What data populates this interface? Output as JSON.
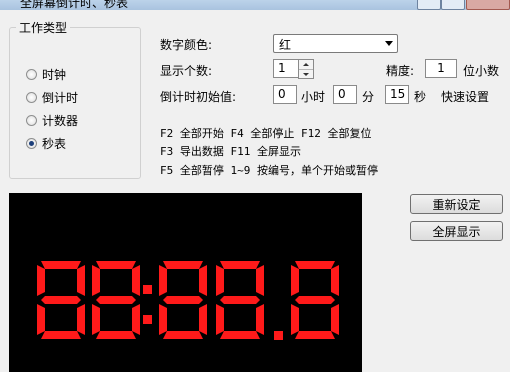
{
  "window": {
    "title": "全屏幕倒计时、秒表"
  },
  "work_type": {
    "legend": "工作类型",
    "options": [
      {
        "label": "时钟",
        "selected": false
      },
      {
        "label": "倒计时",
        "selected": false
      },
      {
        "label": "计数器",
        "selected": false
      },
      {
        "label": "秒表",
        "selected": true
      }
    ]
  },
  "settings": {
    "digit_color_label": "数字颜色:",
    "digit_color_value": "红",
    "display_count_label": "显示个数:",
    "display_count_value": "1",
    "precision_label": "精度:",
    "precision_value": "1",
    "precision_unit": "位小数",
    "countdown_label": "倒计时初始值:",
    "hours_value": "0",
    "hours_unit": "小时",
    "minutes_value": "0",
    "minutes_unit": "分",
    "seconds_value": "15",
    "seconds_unit": "秒",
    "quick_settings": "快速设置"
  },
  "shortcuts": [
    "F2 全部开始 F4 全部停止 F12 全部复位",
    "F3 导出数据 F11 全屏显示",
    "F5 全部暂停 1~9 按编号，单个开始或暂停"
  ],
  "buttons": {
    "reset_settings": "重新设定",
    "fullscreen": "全屏显示"
  },
  "display": {
    "digit_color": "#ff1a1a",
    "dim_color": "#2a0000",
    "text": "88:88.8"
  }
}
